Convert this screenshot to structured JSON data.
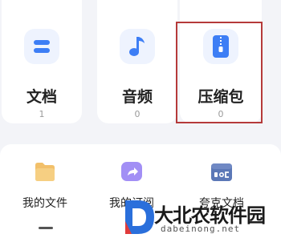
{
  "categories": [
    {
      "label": "文档",
      "count": "1",
      "icon": "document-icon",
      "color": "#3d7ef5"
    },
    {
      "label": "音频",
      "count": "0",
      "icon": "music-note-icon",
      "color": "#3d7ef5"
    },
    {
      "label": "压缩包",
      "count": "0",
      "icon": "zip-archive-icon",
      "color": "#3d7ef5"
    }
  ],
  "bottom_items": [
    {
      "label": "我的文件",
      "icon": "folder-icon",
      "color": "#f2c06a"
    },
    {
      "label": "我的订阅",
      "icon": "share-icon",
      "color": "#9b86f2"
    },
    {
      "label": "夸克文档",
      "icon": "doc-box-icon",
      "color": "#5b78b7"
    }
  ],
  "highlight_color": "#b53a3a",
  "watermark": {
    "title": "大北农软件园",
    "url": "dabeinong.net",
    "color": "#2a6fdb"
  }
}
